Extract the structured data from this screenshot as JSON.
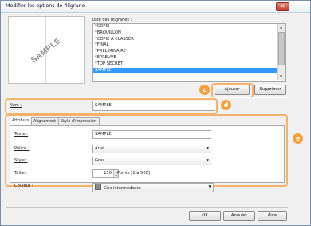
{
  "window": {
    "title": "Modifier les options de filigrane",
    "close_glyph": "✕"
  },
  "preview": {
    "watermark_text": "SAMPLE"
  },
  "watermark_list": {
    "label": "Liste des filigranes :",
    "items": [
      {
        "label": "COPIE",
        "starred": true,
        "selected": false
      },
      {
        "label": "BROUILLON",
        "starred": true,
        "selected": false
      },
      {
        "label": "COPIE A CLASSER",
        "starred": true,
        "selected": false
      },
      {
        "label": "FINAL",
        "starred": true,
        "selected": false
      },
      {
        "label": "PRELIMINAIRE",
        "starred": true,
        "selected": false
      },
      {
        "label": "EPREUVE",
        "starred": true,
        "selected": false
      },
      {
        "label": "TOP SECRET",
        "starred": true,
        "selected": false
      },
      {
        "label": "SAMPLE",
        "starred": false,
        "selected": true
      }
    ],
    "star_glyph": "*"
  },
  "buttons": {
    "add": "Ajouter",
    "delete": "Supprimer",
    "ok": "OK",
    "cancel": "Annuler",
    "help": "Aide"
  },
  "callouts": {
    "c": "c",
    "d": "d",
    "e": "e"
  },
  "name_field": {
    "label": "Nom :",
    "value": "SAMPLE"
  },
  "tabs": [
    {
      "label": "Attributs",
      "active": true
    },
    {
      "label": "Alignement",
      "active": false
    },
    {
      "label": "Style d'impression",
      "active": false
    }
  ],
  "attributes": {
    "text_label": "Texte :",
    "text_value": "SAMPLE",
    "font_label": "Police :",
    "font_value": "Arial",
    "style_label": "Style :",
    "style_value": "Gras",
    "size_label": "Taille :",
    "size_value": "150",
    "size_units": "Points [1 à 500]",
    "color_label": "Couleur :",
    "color_value": "Gris intermédiaire",
    "color_hex": "#8c8c8c"
  },
  "colors": {
    "accent": "#f39f3f",
    "selection": "#3399ff",
    "star": "#c0282d"
  }
}
